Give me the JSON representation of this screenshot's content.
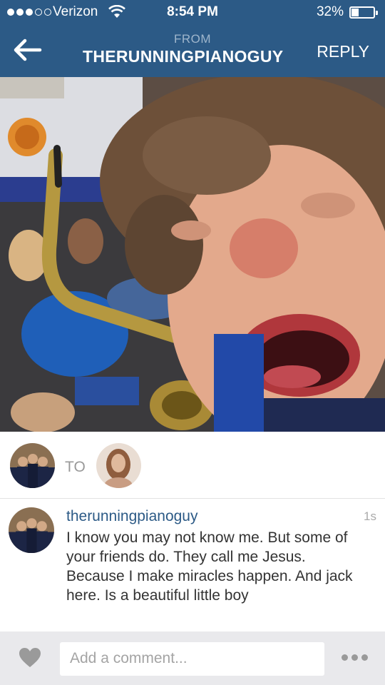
{
  "status_bar": {
    "carrier": "Verizon",
    "time": "8:54 PM",
    "battery_percent": "32%",
    "battery_level": 0.32,
    "signal_bars": 3,
    "signal_max": 5
  },
  "nav": {
    "back_icon": "back-arrow-icon",
    "from_label": "FROM",
    "sender": "THERUNNINGPIANOGUY",
    "reply_label": "REPLY",
    "bar_color": "#2c5a86"
  },
  "recipients": {
    "to_label": "TO"
  },
  "comment": {
    "username": "therunningpianoguy",
    "timestamp": "1s",
    "text": "I know you may not know me. But some of your friends do. They call me Jesus.  Because I make miracles happen.  And jack here.  Is a beautiful little boy",
    "username_color": "#2c5a86"
  },
  "bottom_bar": {
    "heart_icon": "heart-icon",
    "comment_placeholder": "Add a comment...",
    "more_icon": "more-options-icon"
  }
}
